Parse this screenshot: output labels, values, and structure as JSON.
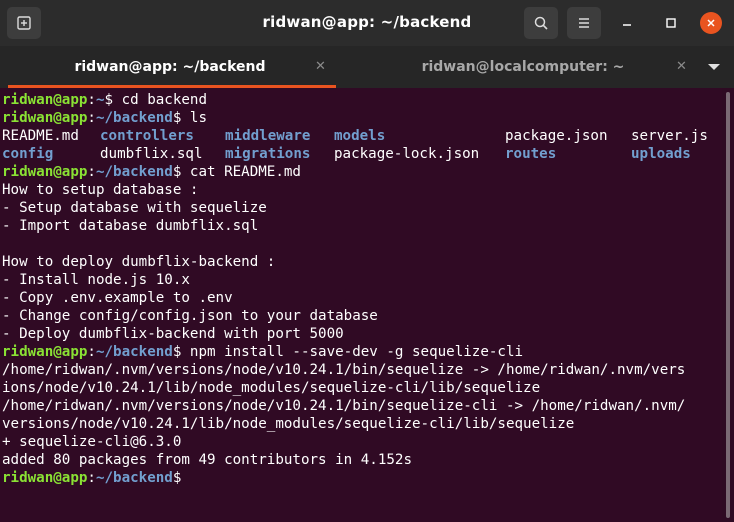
{
  "window": {
    "title": "ridwan@app: ~/backend",
    "new_tab_icon": "new-tab-icon",
    "search_icon": "search-icon",
    "menu_icon": "hamburger-menu-icon"
  },
  "tabs": [
    {
      "label": "ridwan@app: ~/backend",
      "active": true
    },
    {
      "label": "ridwan@localcomputer: ~",
      "active": false
    }
  ],
  "colors": {
    "background": "#300a24",
    "prompt_user": "#8ae234",
    "prompt_path": "#729fcf",
    "accent": "#e95420",
    "close_button": "#e95420"
  },
  "terminal": {
    "prompt_user": "ridwan@app",
    "prompt_colon": ":",
    "prompt_dollar": "$",
    "lines": [
      {
        "path": "~",
        "cmd": " cd backend"
      },
      {
        "path": "~/backend",
        "cmd": " ls"
      },
      {
        "text": "README.md"
      },
      {
        "text": "config"
      },
      {
        "path": "~/backend",
        "cmd": " cat README.md"
      },
      {
        "text": "How to setup database :"
      },
      {
        "text": "- Setup database with sequelize"
      },
      {
        "text": "- Import database dumbflix.sql"
      },
      {
        "text": ""
      },
      {
        "text": "How to deploy dumbflix-backend :"
      },
      {
        "text": "- Install node.js 10.x"
      },
      {
        "text": "- Copy .env.example to .env"
      },
      {
        "text": "- Change config/config.json to your database"
      },
      {
        "text": "- Deploy dumbflix-backend with port 5000"
      },
      {
        "path": "~/backend",
        "cmd": " npm install --save-dev -g sequelize-cli"
      },
      {
        "text": "/home/ridwan/.nvm/versions/node/v10.24.1/bin/sequelize -> /home/ridwan/.nvm/vers"
      },
      {
        "text": "ions/node/v10.24.1/lib/node_modules/sequelize-cli/lib/sequelize"
      },
      {
        "text": "/home/ridwan/.nvm/versions/node/v10.24.1/bin/sequelize-cli -> /home/ridwan/.nvm/"
      },
      {
        "text": "versions/node/v10.24.1/lib/node_modules/sequelize-cli/lib/sequelize"
      },
      {
        "text": "+ sequelize-cli@6.3.0"
      },
      {
        "text": "added 80 packages from 49 contributors in 4.152s"
      },
      {
        "path": "~/backend",
        "cmd": ""
      }
    ],
    "ls_output": {
      "row1": [
        "README.md",
        "controllers",
        "middleware",
        "models",
        "package.json",
        "server.js"
      ],
      "row2": [
        "config",
        "dumbflix.sql",
        "migrations",
        "package-lock.json",
        "routes",
        "uploads"
      ],
      "directories": [
        "controllers",
        "middleware",
        "models",
        "config",
        "migrations",
        "routes",
        "uploads"
      ]
    }
  }
}
